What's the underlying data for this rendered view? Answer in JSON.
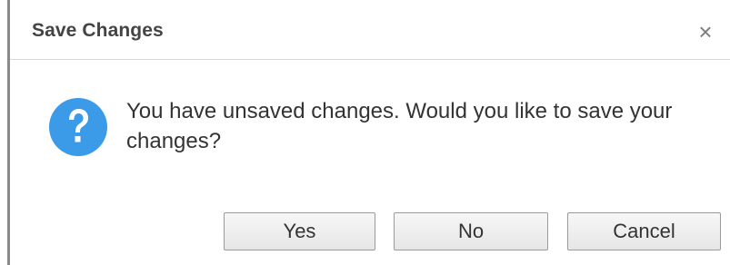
{
  "dialog": {
    "title": "Save Changes",
    "close_icon": "close-icon",
    "close_glyph": "×",
    "icon": "question-icon",
    "icon_color": "#3b9be8",
    "message": "You have unsaved changes. Would you like to save your changes?",
    "buttons": {
      "yes": "Yes",
      "no": "No",
      "cancel": "Cancel"
    }
  }
}
